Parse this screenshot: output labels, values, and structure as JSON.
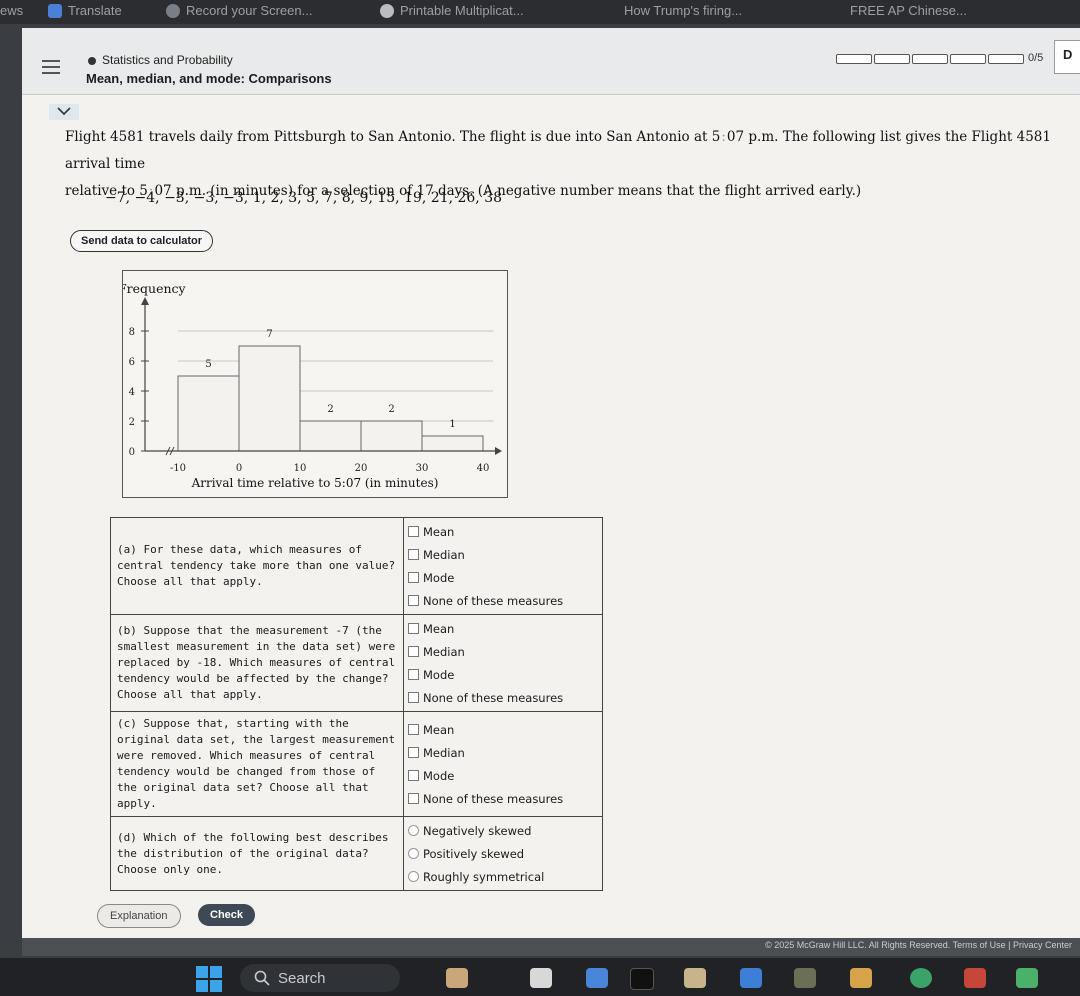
{
  "browser": {
    "bookmarks": [
      "ews",
      "Translate",
      "Record your Screen...",
      "Printable Multiplicat...",
      "How Trump's firing...",
      "FREE AP Chinese..."
    ]
  },
  "header": {
    "topic": "Statistics and Probability",
    "title": "Mean, median, and mode: Comparisons",
    "progress_label": "0/5",
    "progress_segments": 5,
    "progress_filled": 0,
    "corner_button": "D"
  },
  "problem": {
    "line1_a": "Flight 4581 travels daily from Pittsburgh to San Antonio. The flight is due into San Antonio at 5",
    "line1_time": "07",
    "line1_b": "p.m. The following list gives the Flight 4581 arrival time",
    "line2_a": "relative to 5",
    "line2_time": "07",
    "line2_b": "p.m. (in minutes) for a selection of 17 days. (A negative number means that the flight arrived early.)",
    "data_list": "−7, −4, −3, −3, −3, 1, 2, 3, 5, 7, 8, 9, 15, 19, 21, 26, 38",
    "send_button": "Send data to calculator"
  },
  "chart_data": {
    "type": "bar",
    "ylabel": "Frequency",
    "xlabel": "Arrival time relative to 5:07 (in minutes)",
    "bins": [
      [
        -10,
        0
      ],
      [
        0,
        10
      ],
      [
        10,
        20
      ],
      [
        20,
        30
      ],
      [
        30,
        40
      ]
    ],
    "values": [
      5,
      7,
      2,
      2,
      1
    ],
    "x_ticks": [
      "-10",
      "0",
      "10",
      "20",
      "30",
      "40"
    ],
    "y_ticks": [
      "0",
      "2",
      "4",
      "6",
      "8"
    ],
    "ylim": [
      0,
      8
    ],
    "xlim": [
      -10,
      40
    ],
    "bar_color": "#f3f2ee",
    "grid": true
  },
  "questions": [
    {
      "text": "(a) For these data, which measures of central tendency take more than one value? Choose all that apply.",
      "type": "checkbox",
      "options": [
        "Mean",
        "Median",
        "Mode",
        "None of these measures"
      ]
    },
    {
      "text": "(b) Suppose that the measurement -7 (the smallest measurement in the data set) were replaced by -18. Which measures of central tendency would be affected by the change? Choose all that apply.",
      "type": "checkbox",
      "options": [
        "Mean",
        "Median",
        "Mode",
        "None of these measures"
      ]
    },
    {
      "text": "(c) Suppose that, starting with the original data set, the largest measurement were removed. Which measures of central tendency would be changed from those of the original data set? Choose all that apply.",
      "type": "checkbox",
      "options": [
        "Mean",
        "Median",
        "Mode",
        "None of these measures"
      ]
    },
    {
      "text": "(d) Which of the following best describes the distribution of the original data? Choose only one.",
      "type": "radio",
      "options": [
        "Negatively skewed",
        "Positively skewed",
        "Roughly symmetrical"
      ]
    }
  ],
  "footer": {
    "explanation_button": "Explanation",
    "check_button": "Check",
    "copyright": "© 2025 McGraw Hill LLC. All Rights Reserved.   Terms of Use  |  Privacy Center"
  },
  "taskbar": {
    "search_label": "Search"
  },
  "colors": {
    "page_bg": "#f3f2ee",
    "header_bg": "#e9eaeb",
    "check_button": "#3d4a55"
  }
}
